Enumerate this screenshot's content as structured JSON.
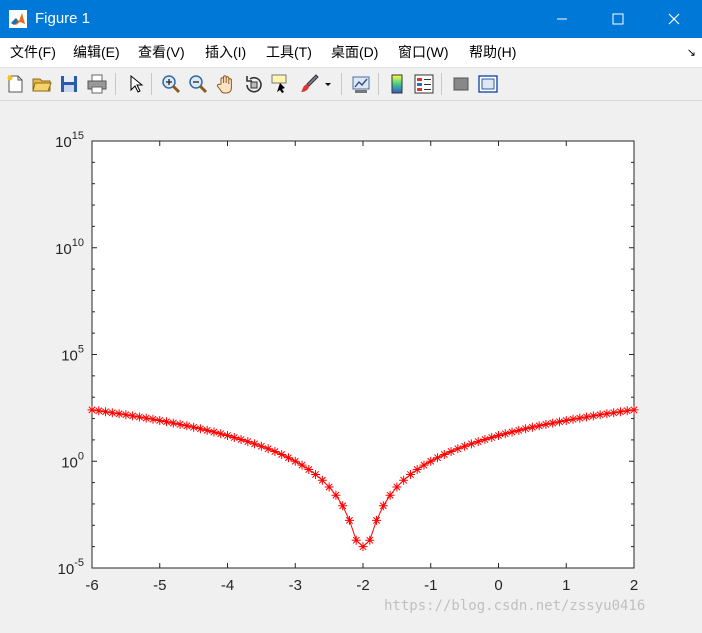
{
  "window": {
    "title": "Figure 1"
  },
  "menu": [
    "文件(F)",
    "编辑(E)",
    "查看(V)",
    "插入(I)",
    "工具(T)",
    "桌面(D)",
    "窗口(W)",
    "帮助(H)"
  ],
  "toolbar_icons": [
    "new-figure-icon",
    "open-file-icon",
    "save-icon",
    "print-icon",
    "pointer-icon",
    "zoom-in-icon",
    "zoom-out-icon",
    "pan-hand-icon",
    "rotate-3d-icon",
    "data-cursor-icon",
    "brush-icon",
    "brush-dropdown-icon",
    "link-plot-icon",
    "colorbar-icon",
    "legend-icon",
    "hide-plot-tools-icon",
    "show-plot-tools-icon"
  ],
  "colors": {
    "titlebar": "#0078d7",
    "series": "#ff0000",
    "figure_bg": "#f0f0f0"
  },
  "watermark": "https://blog.csdn.net/zssyu0416",
  "chart_data": {
    "type": "scatter",
    "marker": "asterisk",
    "line": true,
    "color": "#ff0000",
    "x_formula": "x from -6 to 2 step 0.1",
    "y_formula": "y = (x+2)^4 + 1e-4 (read from the plot)",
    "yscale": "log",
    "xlim": [
      -6,
      2
    ],
    "ylim": [
      1e-05,
      1000000000000000.0
    ],
    "xticks": [
      "-6",
      "-5",
      "-4",
      "-3",
      "-2",
      "-1",
      "0",
      "1",
      "2"
    ],
    "yticks": [
      {
        "base": "10",
        "exp": "-5"
      },
      {
        "base": "10",
        "exp": "0"
      },
      {
        "base": "10",
        "exp": "5"
      },
      {
        "base": "10",
        "exp": "10"
      },
      {
        "base": "10",
        "exp": "15"
      }
    ],
    "grid": false
  }
}
